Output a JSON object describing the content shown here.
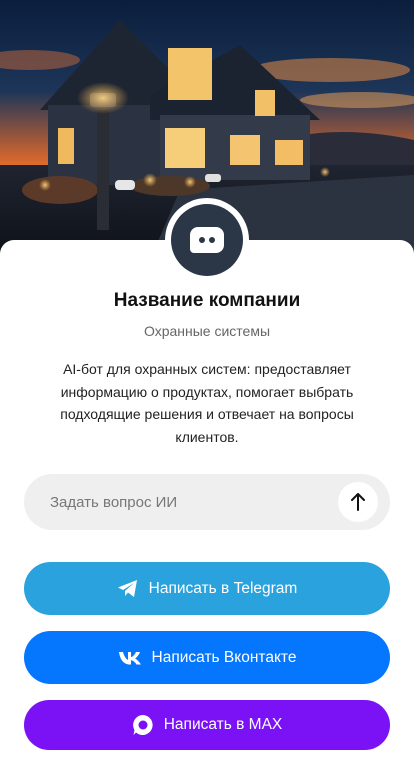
{
  "company": {
    "name": "Название компании",
    "category": "Охранные системы",
    "description": "AI-бот для охранных систем: предоставляет информацию о продуктах, помогает выбрать подходящие решения и отвечает на вопросы клиентов."
  },
  "ask": {
    "placeholder": "Задать вопрос ИИ",
    "send_icon": "arrow-up-icon"
  },
  "buttons": {
    "telegram": {
      "label": "Написать в Telegram",
      "icon": "telegram-icon",
      "color": "#2aa2dd"
    },
    "vk": {
      "label": "Написать Вконтакте",
      "icon": "vk-icon",
      "color": "#0577ff"
    },
    "max": {
      "label": "Написать в MAX",
      "icon": "max-icon",
      "color": "#7a12f5"
    }
  },
  "avatar": {
    "icon": "chat-bot-icon",
    "color": "#2b3646"
  }
}
